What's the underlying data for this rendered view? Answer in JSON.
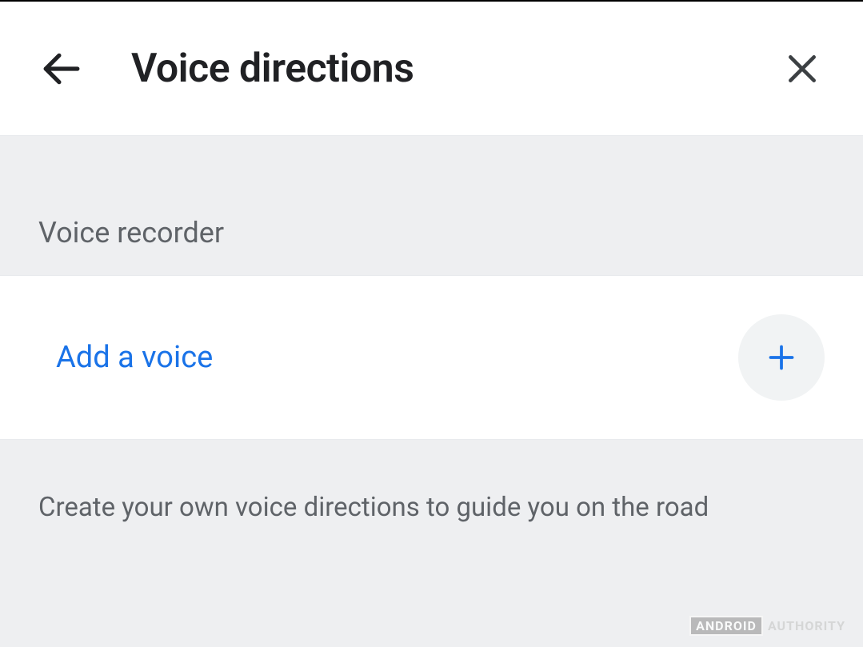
{
  "header": {
    "title": "Voice directions"
  },
  "section": {
    "title": "Voice recorder"
  },
  "action": {
    "label": "Add a voice"
  },
  "description": {
    "text": "Create your own voice directions to guide you on the road"
  },
  "watermark": {
    "brand_left": "ANDROID",
    "brand_right": "AUTHORITY"
  }
}
